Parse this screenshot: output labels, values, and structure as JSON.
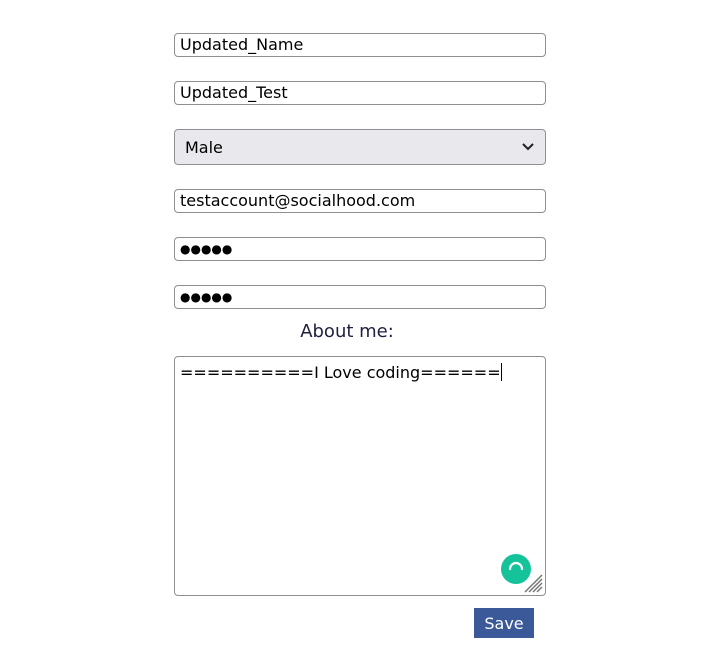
{
  "form": {
    "first_name": "Updated_Name",
    "last_name": "Updated_Test",
    "gender_selected": "Male",
    "email": "testaccount@socialhood.com",
    "password_mask": "●●●●●",
    "confirm_password_mask": "●●●●●",
    "about_label": "About me:",
    "about_text": "==========I Love coding======",
    "save_label": "Save"
  },
  "colors": {
    "save_button": "#3b5998",
    "grammarly": "#15c39a",
    "select_bg": "#e9e9ed"
  },
  "icons": {
    "select_arrow": "chevron-down-icon",
    "assistant": "grammarly-icon",
    "resize": "resize-grip-icon"
  }
}
